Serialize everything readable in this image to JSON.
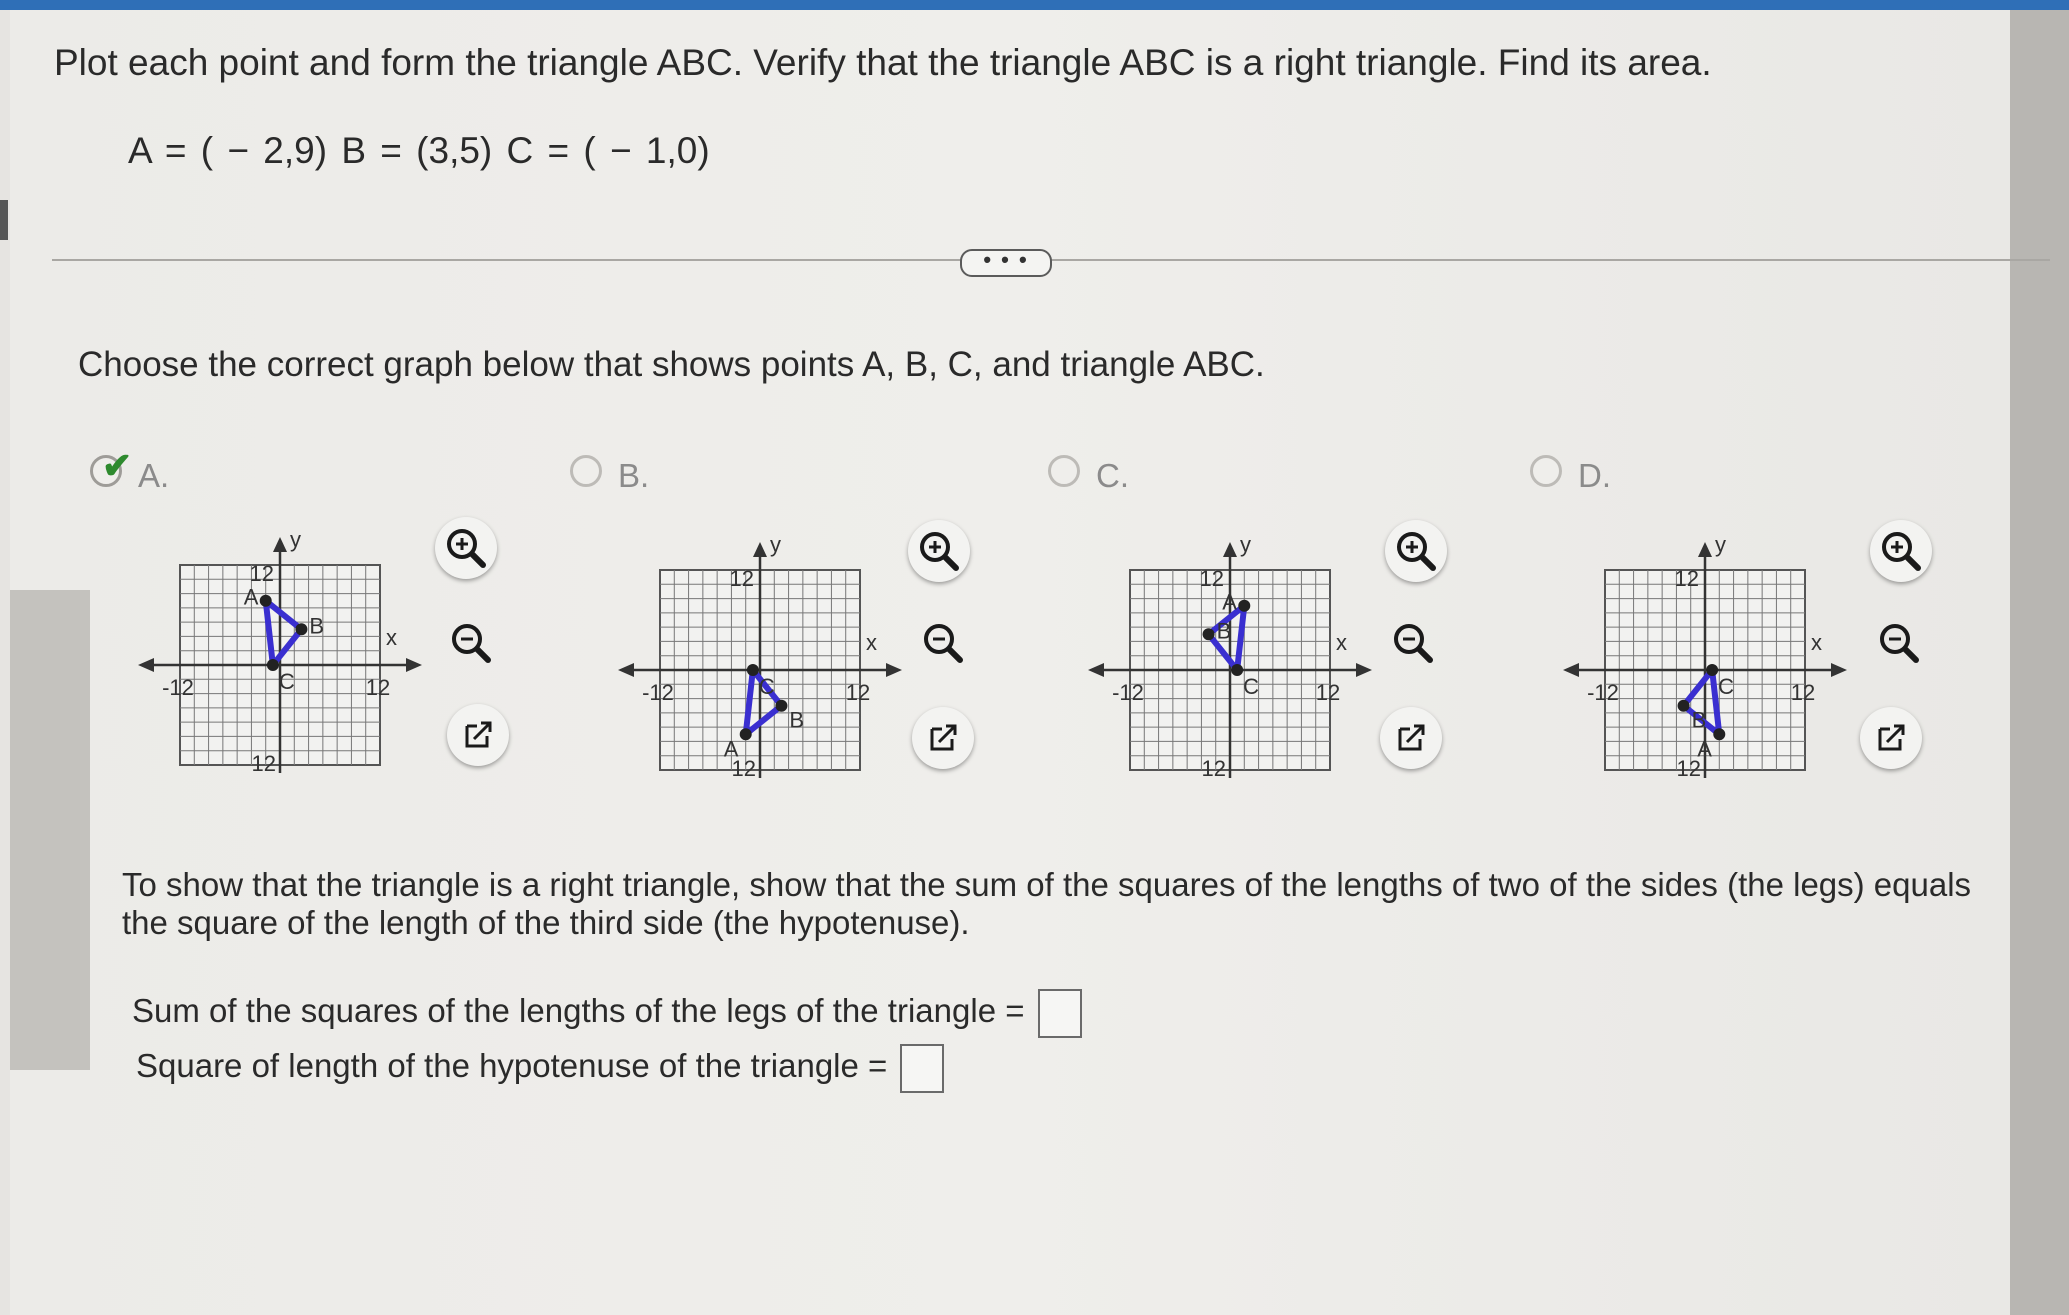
{
  "problem": {
    "prompt": "Plot each point and form the triangle ABC.  Verify that the triangle ABC is a right triangle.  Find its area.",
    "points": "A = ( − 2,9)  B = (3,5)  C = ( − 1,0)"
  },
  "more_button": "• • •",
  "question": "Choose the correct graph below that shows points A, B, C, and triangle ABC.",
  "options": [
    {
      "label": "A.",
      "selected": true
    },
    {
      "label": "B.",
      "selected": false
    },
    {
      "label": "C.",
      "selected": false
    },
    {
      "label": "D.",
      "selected": false
    }
  ],
  "graph_text": {
    "y": "y",
    "x": "x",
    "pos": "12",
    "neg": "-12",
    "pos_bottom": "12"
  },
  "graph_points": {
    "A": {
      "A": [
        -2,
        9
      ],
      "B": [
        3,
        5
      ],
      "C": [
        -1,
        0
      ]
    },
    "B": {
      "A": [
        -2,
        -9
      ],
      "B": [
        3,
        -5
      ],
      "C": [
        -1,
        0
      ]
    },
    "C": {
      "A": [
        2,
        9
      ],
      "B": [
        -3,
        5
      ],
      "C": [
        1,
        0
      ]
    },
    "D": {
      "A": [
        2,
        -9
      ],
      "B": [
        -3,
        -5
      ],
      "C": [
        1,
        0
      ]
    }
  },
  "icons": [
    "zoom-in-icon",
    "zoom-out-icon",
    "open-new-window-icon"
  ],
  "explanation": "To show that the triangle is a right triangle, show that the sum of the squares of the lengths of two of the sides (the legs) equals the square of the length of the third side (the hypotenuse).",
  "answers": {
    "legs_label": "Sum of the squares of the lengths of the legs of the triangle =",
    "legs_value": "",
    "hyp_label": "Square of length of the hypotenuse of the triangle =",
    "hyp_value": ""
  },
  "colors": {
    "triangle": "#3a2fd0",
    "check": "#2e8a2e",
    "accent": "#2f6fb7"
  }
}
